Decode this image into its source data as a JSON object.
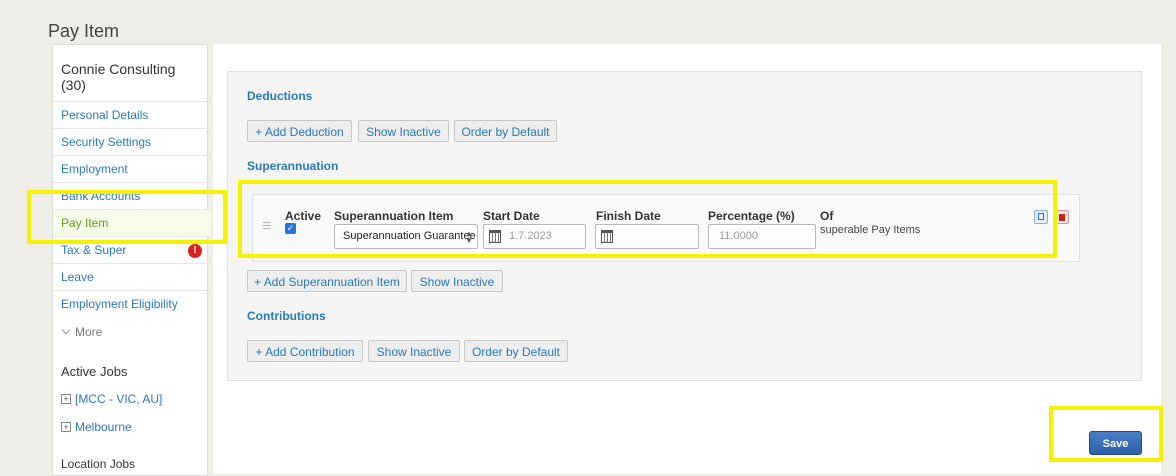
{
  "page_title": "Pay Item",
  "sidebar": {
    "employee_name": "Connie Consulting (30)",
    "items": [
      {
        "label": "Personal Details"
      },
      {
        "label": "Security Settings"
      },
      {
        "label": "Employment"
      },
      {
        "label": "Bank Accounts"
      },
      {
        "label": "Pay Item",
        "active": true
      },
      {
        "label": "Tax & Super",
        "alert": "!"
      },
      {
        "label": "Leave"
      },
      {
        "label": "Employment Eligibility"
      }
    ],
    "more_label": "More",
    "active_jobs_title": "Active Jobs",
    "jobs": [
      {
        "label": "[MCC - VIC, AU]"
      },
      {
        "label": "Melbourne"
      }
    ],
    "cut_off_heading": "Location Jobs"
  },
  "deductions": {
    "title": "Deductions",
    "buttons": [
      "+ Add Deduction",
      "Show Inactive",
      "Order by Default"
    ]
  },
  "superannuation": {
    "title": "Superannuation",
    "headers": {
      "active": "Active",
      "item": "Superannuation Item",
      "start_date": "Start Date",
      "finish_date": "Finish Date",
      "percentage": "Percentage (%)",
      "of": "Of"
    },
    "row": {
      "active": true,
      "item_value": "Superannuation Guarantee",
      "start_date_placeholder": "1.7.2023",
      "finish_date_value": "",
      "percentage_placeholder": "11.0000",
      "of_value": "superable Pay Items"
    },
    "buttons": [
      "+ Add Superannuation Item",
      "Show Inactive"
    ]
  },
  "contributions": {
    "title": "Contributions",
    "buttons": [
      "+ Add Contribution",
      "Show Inactive",
      "Order by Default"
    ]
  },
  "save_label": "Save",
  "colors": {
    "link": "#2a7ab8",
    "highlight": "#f4f200",
    "active_nav": "#6b9a1f",
    "save_button": "#2c5fa8",
    "alert": "#d8201c"
  }
}
